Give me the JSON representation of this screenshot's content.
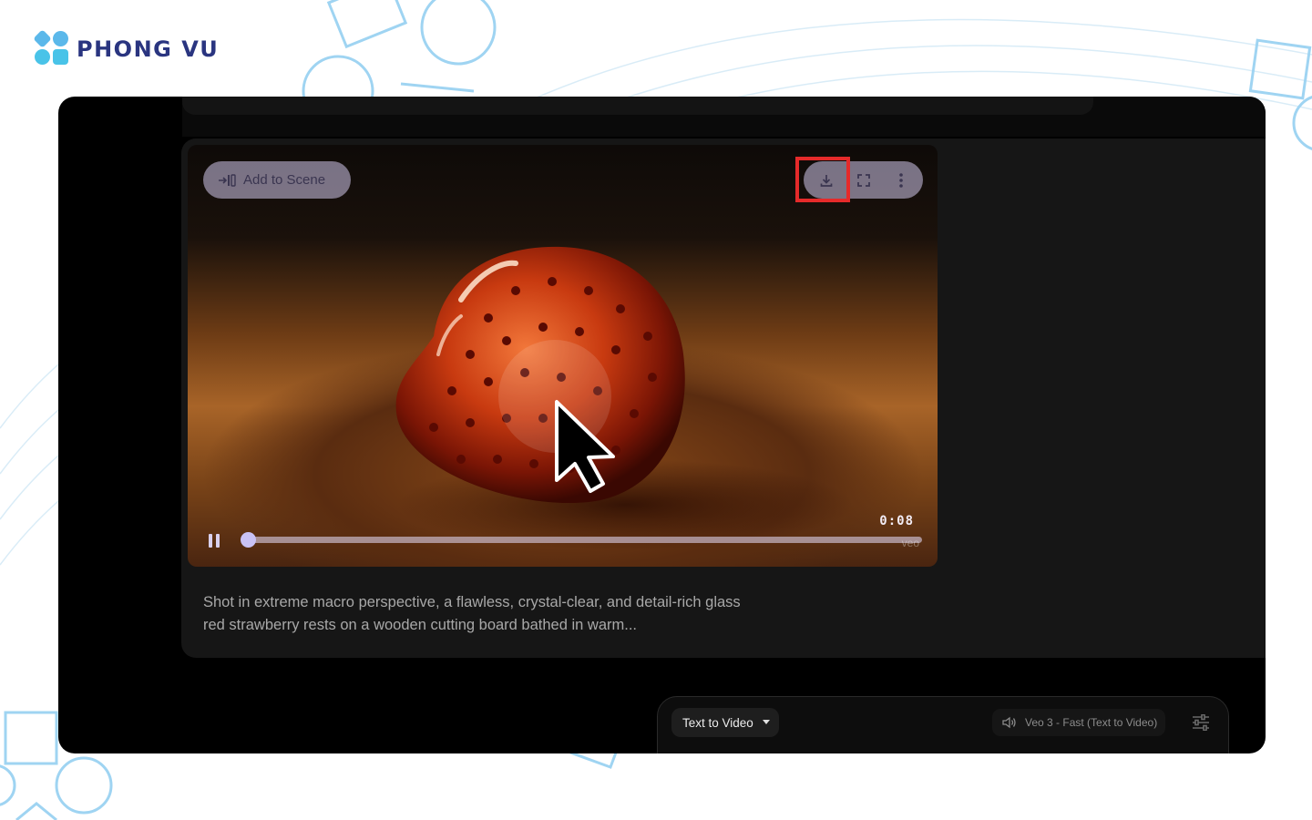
{
  "brand": {
    "name": "PHONG VU",
    "colors": {
      "navy": "#2a3580",
      "light_blue": "#5bb8ea",
      "teal": "#49c3e8"
    }
  },
  "video": {
    "add_to_scene_label": "Add to Scene",
    "time": "0:08",
    "progress": 0.0,
    "watermark": "veo",
    "highlight_color": "#e52a2a",
    "icons": [
      "download-icon",
      "fullscreen-icon",
      "more-vert-icon",
      "pause-icon",
      "add-to-scene-icon"
    ]
  },
  "description": "Shot in extreme macro perspective, a flawless, crystal-clear, and detail-rich glass red strawberry rests on a wooden cutting board bathed in warm...",
  "prompt_bar": {
    "mode_label": "Text to Video",
    "model_label": "Veo 3 - Fast (Text to Video)"
  }
}
